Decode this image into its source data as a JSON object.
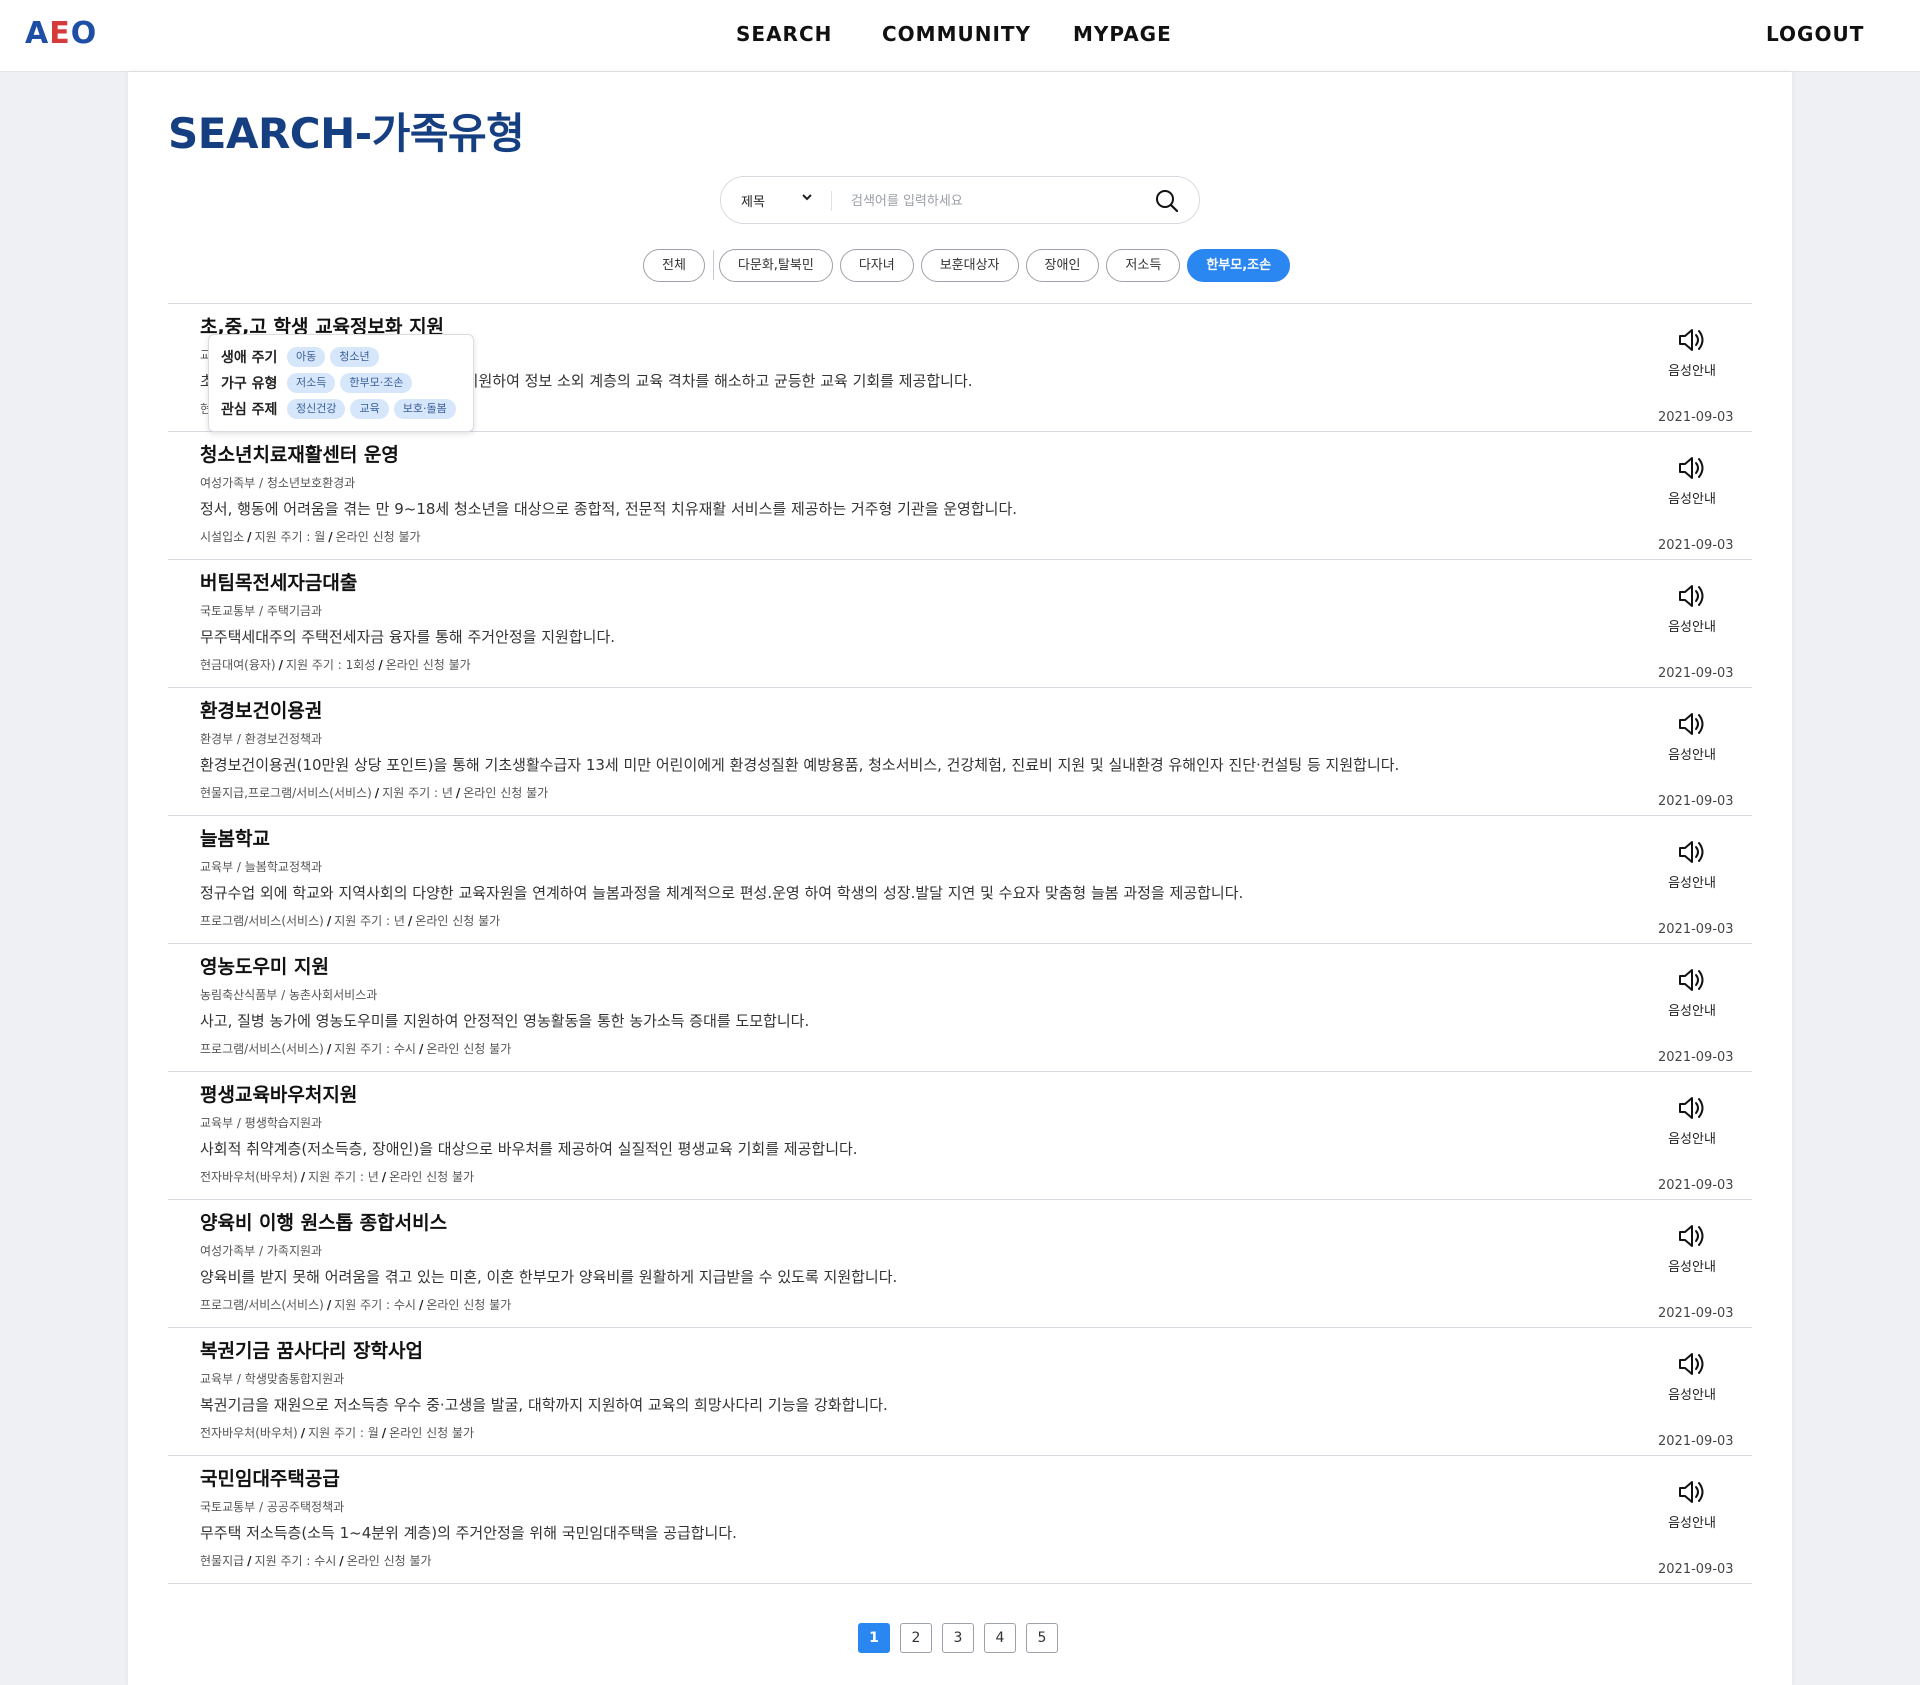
{
  "header": {
    "logo": [
      "A",
      "E",
      "O"
    ],
    "nav": {
      "search": "SEARCH",
      "community": "COMMUNITY",
      "mypage": "MYPAGE",
      "logout": "LOGOUT"
    }
  },
  "page": {
    "title": "SEARCH-가족유형"
  },
  "search": {
    "select_value": "제목",
    "placeholder": "검색어를 입력하세요"
  },
  "filters": [
    {
      "label": "전체",
      "active": false
    },
    {
      "label": "다문화,탈북민",
      "active": false
    },
    {
      "label": "다자녀",
      "active": false
    },
    {
      "label": "보훈대상자",
      "active": false
    },
    {
      "label": "장애인",
      "active": false
    },
    {
      "label": "저소득",
      "active": false
    },
    {
      "label": "한부모,조손",
      "active": true
    }
  ],
  "popup": {
    "rows": [
      {
        "label": "생애 주기",
        "tags": [
          "아동",
          "청소년"
        ]
      },
      {
        "label": "가구 유형",
        "tags": [
          "저소득",
          "한부모·조손"
        ]
      },
      {
        "label": "관심 주제",
        "tags": [
          "정신건강",
          "교육",
          "보호·돌봄"
        ]
      }
    ]
  },
  "audio_label": "음성안내",
  "meta_separator": "/",
  "items": [
    {
      "title": "초,중,고 학생 교육정보화 지원",
      "dept": "교육부 / 교육정보화과",
      "desc": "초,중,고 학생에게 인터넷 통신비 및 PC를 지원하여 정보 소외 계층의 교육 격차를 해소하고 균등한 교육 기회를 제공합니다.",
      "meta": [
        "현금지급",
        "지원 주기 : 년",
        "온라인 신청 가능"
      ],
      "date": "2021-09-03"
    },
    {
      "title": "청소년치료재활센터 운영",
      "dept": "여성가족부 / 청소년보호환경과",
      "desc": "정서, 행동에 어려움을 겪는 만 9~18세 청소년을 대상으로 종합적, 전문적 치유재활 서비스를 제공하는 거주형 기관을 운영합니다.",
      "meta": [
        "시설입소",
        "지원 주기 : 월",
        "온라인 신청 불가"
      ],
      "date": "2021-09-03"
    },
    {
      "title": "버팀목전세자금대출",
      "dept": "국토교통부 / 주택기금과",
      "desc": "무주택세대주의 주택전세자금 융자를 통해 주거안정을 지원합니다.",
      "meta": [
        "현금대여(융자)",
        "지원 주기 : 1회성",
        "온라인 신청 불가"
      ],
      "date": "2021-09-03"
    },
    {
      "title": "환경보건이용권",
      "dept": "환경부 / 환경보건정책과",
      "desc": "환경보건이용권(10만원 상당 포인트)을 통해 기초생활수급자 13세 미만 어린이에게 환경성질환 예방용품, 청소서비스, 건강체험, 진료비 지원 및 실내환경 유해인자 진단·컨설팅 등 지원합니다.",
      "meta": [
        "현물지급,프로그램/서비스(서비스)",
        "지원 주기 : 년",
        "온라인 신청 불가"
      ],
      "date": "2021-09-03"
    },
    {
      "title": "늘봄학교",
      "dept": "교육부 / 늘봄학교정책과",
      "desc": "정규수업 외에 학교와 지역사회의 다양한 교육자원을 연계하여 늘봄과정을 체계적으로 편성.운영 하여 학생의 성장.발달 지연 및 수요자 맞춤형 늘봄 과정을 제공합니다.",
      "meta": [
        "프로그램/서비스(서비스)",
        "지원 주기 : 년",
        "온라인 신청 불가"
      ],
      "date": "2021-09-03"
    },
    {
      "title": "영농도우미 지원",
      "dept": "농림축산식품부 / 농촌사회서비스과",
      "desc": "사고, 질병 농가에 영농도우미를 지원하여 안정적인 영농활동을 통한 농가소득 증대를 도모합니다.",
      "meta": [
        "프로그램/서비스(서비스)",
        "지원 주기 : 수시",
        "온라인 신청 불가"
      ],
      "date": "2021-09-03"
    },
    {
      "title": "평생교육바우처지원",
      "dept": "교육부 / 평생학습지원과",
      "desc": "사회적 취약계층(저소득층, 장애인)을 대상으로 바우처를 제공하여 실질적인 평생교육 기회를 제공합니다.",
      "meta": [
        "전자바우처(바우처)",
        "지원 주기 : 년",
        "온라인 신청 불가"
      ],
      "date": "2021-09-03"
    },
    {
      "title": "양육비 이행 원스톱 종합서비스",
      "dept": "여성가족부 / 가족지원과",
      "desc": "양육비를 받지 못해 어려움을 겪고 있는 미혼, 이혼 한부모가 양육비를 원활하게 지급받을 수 있도록 지원합니다.",
      "meta": [
        "프로그램/서비스(서비스)",
        "지원 주기 : 수시",
        "온라인 신청 불가"
      ],
      "date": "2021-09-03"
    },
    {
      "title": "복권기금 꿈사다리 장학사업",
      "dept": "교육부 / 학생맞춤통합지원과",
      "desc": "복권기금을 재원으로 저소득층 우수 중·고생을 발굴, 대학까지 지원하여 교육의 희망사다리 기능을 강화합니다.",
      "meta": [
        "전자바우처(바우처)",
        "지원 주기 : 월",
        "온라인 신청 불가"
      ],
      "date": "2021-09-03"
    },
    {
      "title": "국민임대주택공급",
      "dept": "국토교통부 / 공공주택정책과",
      "desc": "무주택 저소득층(소득 1~4분위 계층)의 주거안정을 위해 국민임대주택을 공급합니다.",
      "meta": [
        "현물지급",
        "지원 주기 : 수시",
        "온라인 신청 불가"
      ],
      "date": "2021-09-03"
    }
  ],
  "pagination": {
    "pages": [
      "1",
      "2",
      "3",
      "4",
      "5"
    ],
    "current": "1"
  }
}
